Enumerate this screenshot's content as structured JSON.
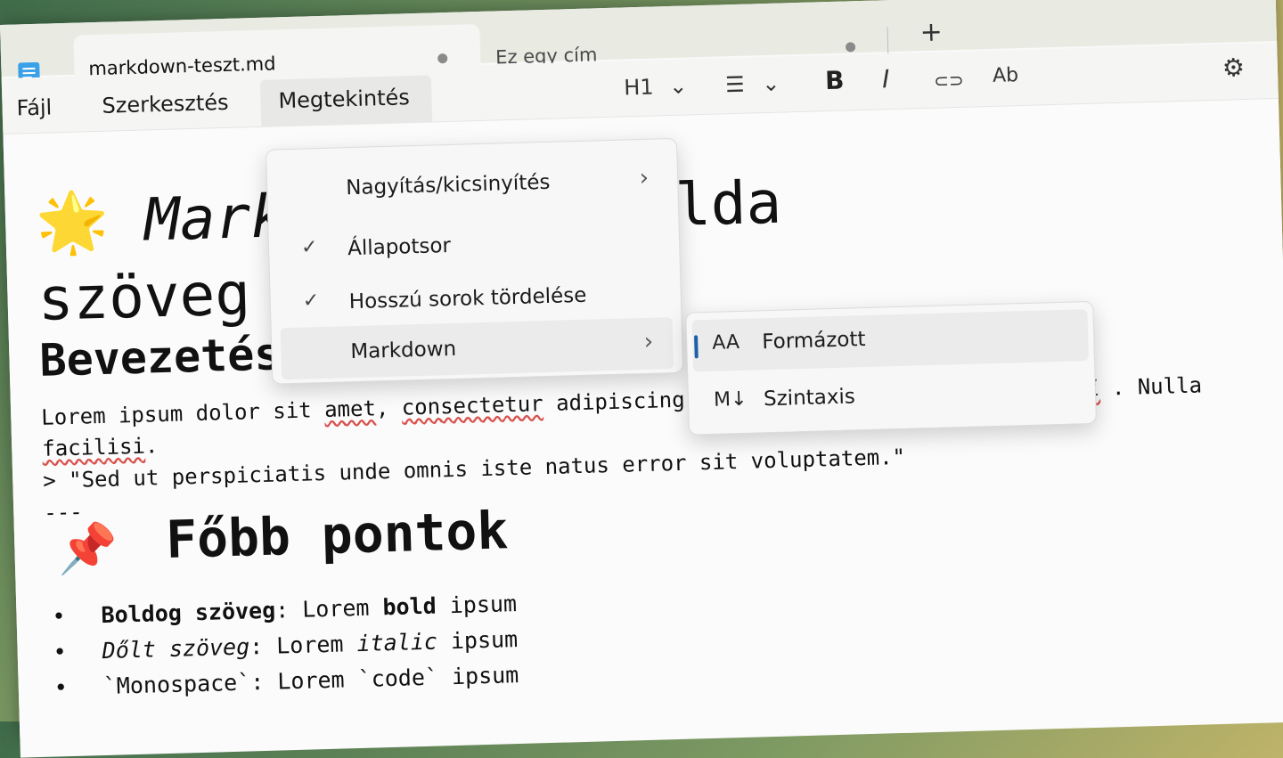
{
  "window": {
    "controls": {
      "minimize": "—",
      "maximize": "☐",
      "close": "✕"
    }
  },
  "tabs": [
    {
      "title": "markdown-teszt.md",
      "active": true,
      "unsaved_indicator": "●"
    },
    {
      "title": "Ez egy cím",
      "active": false,
      "unsaved_indicator": "●"
    }
  ],
  "new_tab_label": "+",
  "menubar": {
    "items": [
      "Fájl",
      "Szerkesztés",
      "Megtekintés"
    ],
    "open_item": "Megtekintés"
  },
  "toolbar": {
    "heading_label": "H1",
    "heading_chevron": "⌄",
    "list_icon": "☰",
    "list_chevron": "⌄",
    "bold_label": "B",
    "italic_label": "I",
    "link_icon": "⊂⊃",
    "clear_format_icon": "Ab",
    "settings_icon": "⚙"
  },
  "view_menu": {
    "items": [
      {
        "label": "Nagyítás/kicsinyítés",
        "checked": false,
        "submenu": true
      },
      {
        "label": "Állapotsor",
        "checked": true,
        "submenu": false
      },
      {
        "label": "Hosszú sorok tördelése",
        "checked": true,
        "submenu": false
      },
      {
        "label": "Markdown",
        "checked": false,
        "submenu": true
      }
    ],
    "check_glyph": "✓",
    "chevron_glyph": "›"
  },
  "markdown_submenu": {
    "items": [
      {
        "label": "Formázott",
        "icon": "AA",
        "selected": true
      },
      {
        "label": "Szintaxis",
        "icon": "M↓",
        "selected": false
      }
    ]
  },
  "document": {
    "h1_emoji": "🌟",
    "h1_italic": "Markdown",
    "h1_rest": "– A példa",
    "h1_line2": "szöveg",
    "intro_heading": "Bevezetés",
    "para_line1_a": "Lorem ipsum dolor sit ",
    "para_line1_b": "amet",
    "para_line1_c": ", ",
    "para_line1_d": "consectetur",
    "para_line1_e": " adipiscing elit. ",
    "para_line1_f": "ti",
    "para_line1_g": ". Nulla",
    "para_line2": "facilisi",
    "para_line2_end": ".",
    "quote_line": "> \"Sed ut perspiciatis unde omnis iste natus error sit voluptatem.\"",
    "hr": "---",
    "section_emoji": "📌",
    "section_heading": "Főbb pontok",
    "list": [
      {
        "label": "Boldog szöveg",
        "sep": ": Lorem ",
        "inner": "bold",
        "end": " ipsum"
      },
      {
        "label": "Dőlt szöveg",
        "sep": ": Lorem ",
        "inner": "italic",
        "end": " ipsum"
      },
      {
        "label": "`Monospace`",
        "sep": ": Lorem ",
        "inner": "`code`",
        "end": " ipsum"
      }
    ],
    "bullet": "•"
  }
}
